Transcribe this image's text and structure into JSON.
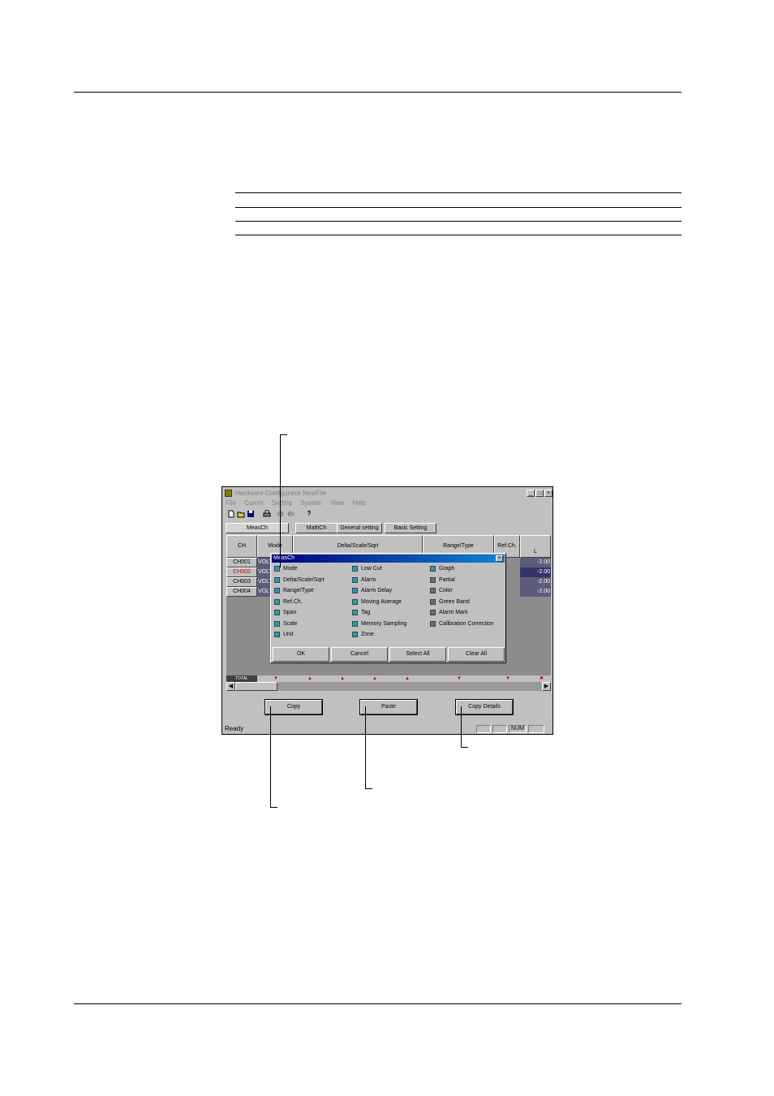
{
  "window": {
    "title": "Hardware Configurator NewFile",
    "controls": {
      "minimize": "_",
      "maximize": "□",
      "close": "×"
    }
  },
  "menu": [
    "File",
    "Comm",
    "Setting",
    "System",
    "View",
    "Help"
  ],
  "toolbar_icons": [
    "new-file-icon",
    "open-folder-icon",
    "save-icon",
    "print-icon",
    "send-icon",
    "receive-icon",
    "help-icon"
  ],
  "tabs": [
    "MeasCh",
    "MathCh",
    "General setting",
    "Basic Setting"
  ],
  "grid": {
    "headers": [
      "CH",
      "Mode",
      "Delta/Scale/Sqrt",
      "Range/Type",
      "Ref.Ch.",
      "L"
    ],
    "rows": [
      {
        "ch": "CH001",
        "mode": "VOLT",
        "l": "-2.00"
      },
      {
        "ch": "CH002",
        "mode": "VOLT",
        "l": "-2.00"
      },
      {
        "ch": "CH003",
        "mode": "VOLT",
        "l": "-2.00"
      },
      {
        "ch": "CH004",
        "mode": "VOLT",
        "l": "-2.00"
      }
    ],
    "total_label": "TOTAL"
  },
  "buttons": {
    "copy": "Copy",
    "paste": "Paste",
    "copy_details": "Copy Details"
  },
  "status": {
    "ready": "Ready",
    "num": "NUM"
  },
  "dialog": {
    "title": "MeasCh",
    "close": "×",
    "col1": [
      {
        "label": "Mode",
        "checked": true
      },
      {
        "label": "Delta/Scale/Sqrt",
        "checked": true
      },
      {
        "label": "Range/Type",
        "checked": true
      },
      {
        "label": "Ref.Ch.",
        "checked": true
      },
      {
        "label": "Span",
        "checked": true
      },
      {
        "label": "Scale",
        "checked": true
      },
      {
        "label": "Unit",
        "checked": true
      }
    ],
    "col2": [
      {
        "label": "Low Cut",
        "checked": true
      },
      {
        "label": "Alarm",
        "checked": true
      },
      {
        "label": "Alarm Delay",
        "checked": true
      },
      {
        "label": "Moving Average",
        "checked": true
      },
      {
        "label": "Tag",
        "checked": true
      },
      {
        "label": "Memory Sampling",
        "checked": true
      },
      {
        "label": "Zone",
        "checked": true
      }
    ],
    "col3": [
      {
        "label": "Graph",
        "checked": true
      },
      {
        "label": "Partial",
        "checked": false
      },
      {
        "label": "Color",
        "checked": false
      },
      {
        "label": "Green Band",
        "checked": false
      },
      {
        "label": "Alarm Mark",
        "checked": false
      },
      {
        "label": "Calibration Correction",
        "checked": false
      }
    ],
    "buttons": [
      "OK",
      "Cancel",
      "Select All",
      "Clear All"
    ]
  },
  "colors": {
    "dialog_title": "#000080",
    "checked": "#1aa0b8",
    "unchecked": "#6e6e6e",
    "selected_ch": "#d00000"
  }
}
